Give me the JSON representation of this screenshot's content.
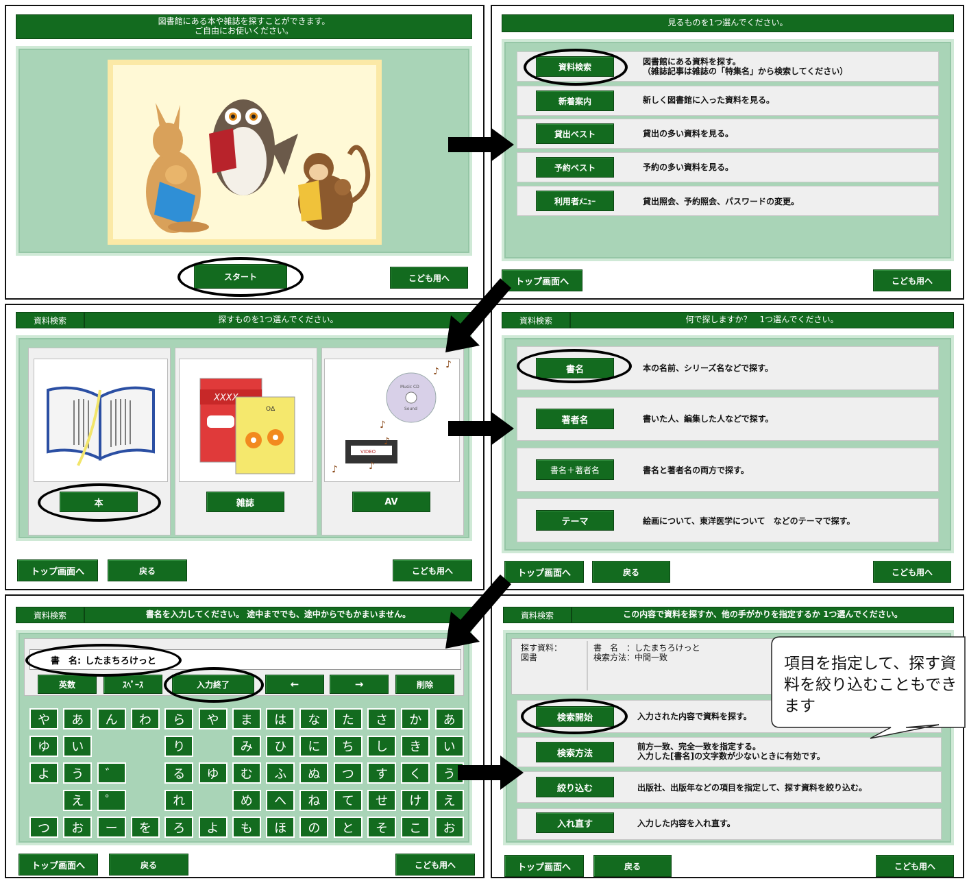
{
  "p1": {
    "header": "図書館にある本や雑誌を探すことができます。\nご自由にお使いください。",
    "start": "スタート",
    "kids": "こども用へ"
  },
  "p2": {
    "header": "見るものを1つ選んでください。",
    "items": [
      {
        "label": "資料検索",
        "desc": "図書館にある資料を探す。\n（雑誌記事は雑誌の「特集名」から検索してください）"
      },
      {
        "label": "新着案内",
        "desc": "新しく図書館に入った資料を見る。"
      },
      {
        "label": "貸出ベスト",
        "desc": "貸出の多い資料を見る。"
      },
      {
        "label": "予約ベスト",
        "desc": "予約の多い資料を見る。"
      },
      {
        "label": "利用者ﾒﾆｭｰ",
        "desc": "貸出照会、予約照会、パスワードの変更。"
      }
    ],
    "top": "トップ画面へ",
    "kids": "こども用へ"
  },
  "p3": {
    "tag": "資料検索",
    "header": "探すものを1つ選んでください。",
    "book": "本",
    "magazine": "雑誌",
    "av": "AV",
    "mag_cover": "XXXX",
    "mag_logo": "OΔ",
    "cd_text1": "Music CD",
    "cd_text2": "Sound",
    "video_label": "VIDEO",
    "top": "トップ画面へ",
    "back": "戻る",
    "kids": "こども用へ"
  },
  "p4": {
    "tag": "資料検索",
    "header": "何で探しますか？　1つ選んでください。",
    "items": [
      {
        "label": "書名",
        "desc": "本の名前、シリーズ名などで探す。"
      },
      {
        "label": "著者名",
        "desc": "書いた人、編集した人などで探す。"
      },
      {
        "label": "書名＋著者名",
        "desc": "書名と著者名の両方で探す。"
      },
      {
        "label": "テーマ",
        "desc": "絵画について、東洋医学について　などのテーマで探す。"
      }
    ],
    "top": "トップ画面へ",
    "back": "戻る",
    "kids": "こども用へ"
  },
  "p5": {
    "tag": "資料検索",
    "header": "書名を入力してください。 途中まででも、途中からでもかまいません。",
    "field_label": "書　名:",
    "field_value": "したまちろけっと",
    "controls": {
      "alpha": "英数",
      "space": "ｽﾍﾟｰｽ",
      "done": "入力終了",
      "left": "←",
      "right": "→",
      "delete": "削除"
    },
    "keys": [
      [
        "や",
        "あ",
        "ん",
        "わ",
        "ら",
        "や",
        "ま",
        "は",
        "な",
        "た",
        "さ",
        "か",
        "あ"
      ],
      [
        "ゆ",
        "い",
        "",
        "",
        "り",
        "",
        "み",
        "ひ",
        "に",
        "ち",
        "し",
        "き",
        "い"
      ],
      [
        "よ",
        "う",
        "゛",
        "",
        "る",
        "ゆ",
        "む",
        "ふ",
        "ぬ",
        "つ",
        "す",
        "く",
        "う"
      ],
      [
        "",
        "え",
        "゜",
        "",
        "れ",
        "",
        "め",
        "へ",
        "ね",
        "て",
        "せ",
        "け",
        "え"
      ],
      [
        "つ",
        "お",
        "ー",
        "を",
        "ろ",
        "よ",
        "も",
        "ほ",
        "の",
        "と",
        "そ",
        "こ",
        "お"
      ]
    ],
    "top": "トップ画面へ",
    "back": "戻る",
    "kids": "こども用へ"
  },
  "p6": {
    "tag": "資料検索",
    "header": "この内容で資料を探すか、他の手がかりを指定するか 1つ選んでください。",
    "info_label": "探す資料：\n図書",
    "info_value": "書　名　：したまちろけっと\n検索方法：中間一致",
    "items": [
      {
        "label": "検索開始",
        "desc": "入力された内容で資料を探す。"
      },
      {
        "label": "検索方法",
        "desc": "前方一致、完全一致を指定する。\n入力した[書名]の文字数が少ないときに有効です。"
      },
      {
        "label": "絞り込む",
        "desc": "出版社、出版年などの項目を指定して、探す資料を絞り込む。"
      },
      {
        "label": "入れ直す",
        "desc": "入力した内容を入れ直す。"
      }
    ],
    "callout": "項目を指定して、探す資料を絞り込むこともできます",
    "top": "トップ画面へ",
    "back": "戻る",
    "kids": "こども用へ"
  },
  "colors": {
    "green": "#136b1f",
    "panel": "#a9d4b7"
  }
}
